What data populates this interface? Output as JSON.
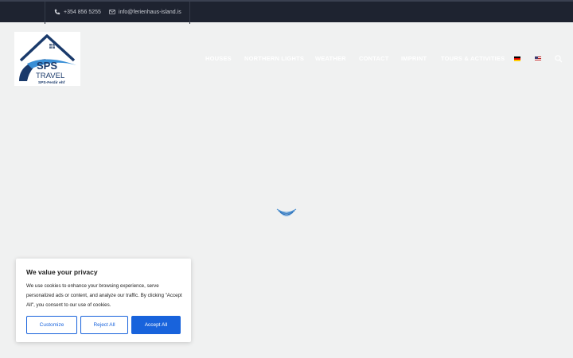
{
  "topbar": {
    "phone": "+354 856 5255",
    "email": "info@ferienhaus-island.is",
    "phone_icon": "phone-icon",
    "email_icon": "envelope-icon"
  },
  "logo": {
    "brand": "SPS",
    "sub": "TRAVEL",
    "company": "SPS-Ferdir ehf"
  },
  "nav": {
    "items": [
      "HOUSES",
      "NORTHERN LIGHTS",
      "WEATHER",
      "CONTACT",
      "IMPRINT",
      "TOURS & ACTIVITIES"
    ],
    "languages": [
      "de-flag-icon",
      "us-flag-icon"
    ],
    "search_icon": "search-icon"
  },
  "cookie": {
    "title": "We value your privacy",
    "text": "We use cookies to enhance your browsing experience, serve personalized ads or content, and analyze our traffic. By clicking \"Accept All\", you consent to our use of cookies.",
    "customize": "Customize",
    "reject": "Reject All",
    "accept": "Accept All",
    "accent_color": "#1863dc"
  },
  "colors": {
    "topbar_bg": "#1e2330",
    "page_bg": "#f0f1f1"
  }
}
